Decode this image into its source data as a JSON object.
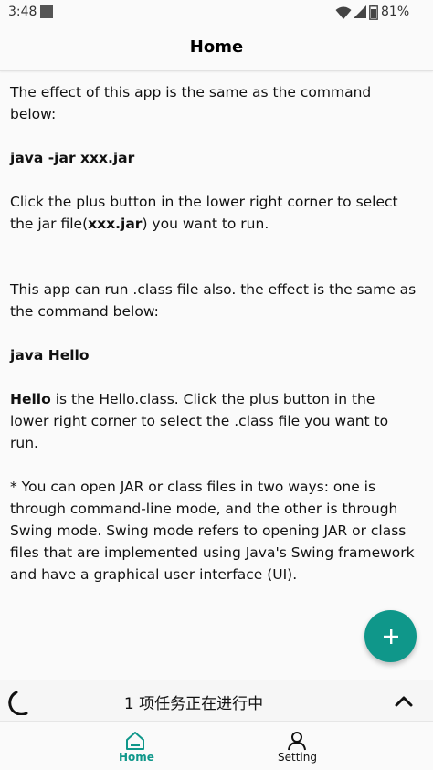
{
  "status_bar": {
    "time": "3:48",
    "battery_percent": "81%",
    "icons": [
      "notification-square-icon",
      "wifi-icon",
      "signal-icon",
      "battery-icon"
    ]
  },
  "app_bar": {
    "title": "Home"
  },
  "content": {
    "intro": "The effect of this app is the same as the command below:",
    "command_jar": "java -jar xxx.jar",
    "click_prefix": "Click the plus button in the lower right corner to select the jar file(",
    "click_bold": "xxx.jar",
    "click_suffix": ") you want to run.",
    "class_intro": "This app can run .class file also. the effect is the same as the command below:",
    "command_class": "java Hello",
    "hello_bold": "Hello",
    "hello_rest": " is the Hello.class. Click the plus button in the lower right corner to select the .class file you want to run.",
    "note": "* You can open JAR or class files in two ways: one is through command-line mode, and the other is through Swing mode. Swing mode refers to opening JAR or class files that are implemented using Java's Swing framework and have a graphical user interface (UI)."
  },
  "fab": {
    "icon": "plus-icon",
    "color": "#0f978a"
  },
  "task_bar": {
    "text": "1 项任务正在进行中",
    "icons": [
      "spinner-icon",
      "chevron-up-icon"
    ]
  },
  "bottom_nav": {
    "items": [
      {
        "label": "Home",
        "icon": "home-icon",
        "active": true
      },
      {
        "label": "Setting",
        "icon": "person-icon",
        "active": false
      }
    ],
    "accent": "#0f978a"
  }
}
